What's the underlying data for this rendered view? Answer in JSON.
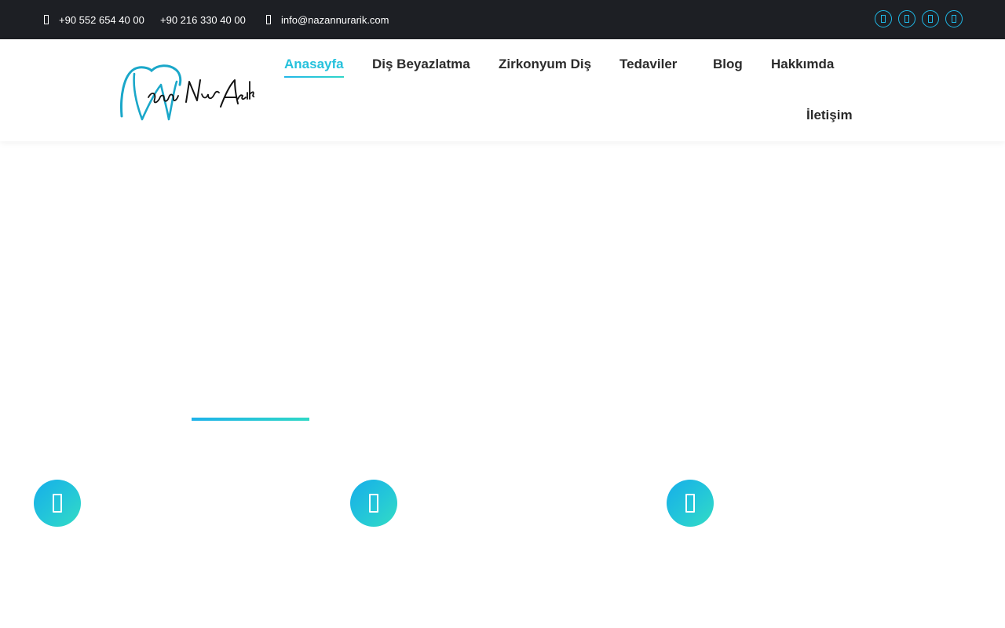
{
  "topbar": {
    "phone1": "+90 552 654 40 00",
    "phone2": "+90 216 330 40 00",
    "email": "info@nazannurarik.com",
    "socials": [
      "facebook-icon",
      "twitter-icon",
      "instagram-icon",
      "youtube-icon"
    ]
  },
  "header": {
    "logo_text": "Nazan Nur Arık",
    "nav": [
      {
        "label": "Anasayfa",
        "active": true
      },
      {
        "label": "Diş Beyazlatma"
      },
      {
        "label": "Zirkonyum Diş"
      },
      {
        "label": "Tedaviler"
      },
      {
        "label": "Blog"
      },
      {
        "label": "Hakkımda"
      },
      {
        "label": "İletişim"
      }
    ]
  },
  "features": {
    "icons": [
      "feature-icon-1",
      "feature-icon-2",
      "feature-icon-3"
    ]
  },
  "colors": {
    "accent": "#25c1dc",
    "gradient_start": "#16aee9",
    "gradient_end": "#33dcc4",
    "topbar_bg": "#1d1f24"
  }
}
